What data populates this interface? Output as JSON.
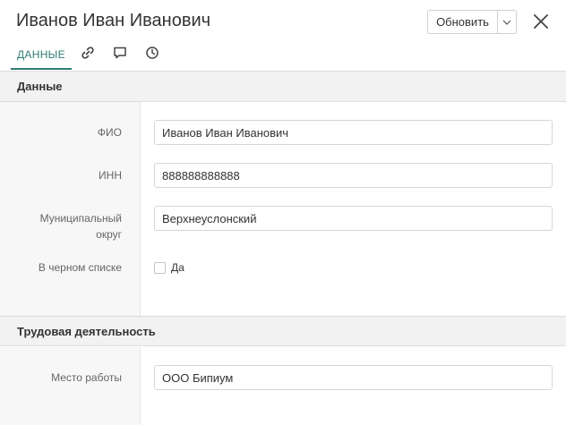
{
  "header": {
    "title": "Иванов Иван Иванович",
    "update_label": "Обновить"
  },
  "tabs": {
    "data_label": "ДАННЫЕ",
    "icons": [
      "link-icon",
      "comment-icon",
      "history-icon"
    ]
  },
  "sections": [
    {
      "title": "Данные",
      "fields": {
        "fio": {
          "label": "ФИО",
          "value": "Иванов Иван Иванович"
        },
        "inn": {
          "label": "ИНН",
          "value": "888888888888"
        },
        "district": {
          "label_line1": "Муниципальный",
          "label_line2": "округ",
          "value": "Верхнеуслонский"
        },
        "blacklist": {
          "label": "В черном списке",
          "option": "Да",
          "checked": false
        }
      }
    },
    {
      "title": "Трудовая деятельность",
      "fields": {
        "workplace": {
          "label": "Место работы",
          "value": "ООО Бипиум"
        }
      }
    }
  ],
  "colors": {
    "accent": "#2e7d74",
    "section_bg": "#f2f2f2",
    "label_col_bg": "#f7f7f7"
  }
}
